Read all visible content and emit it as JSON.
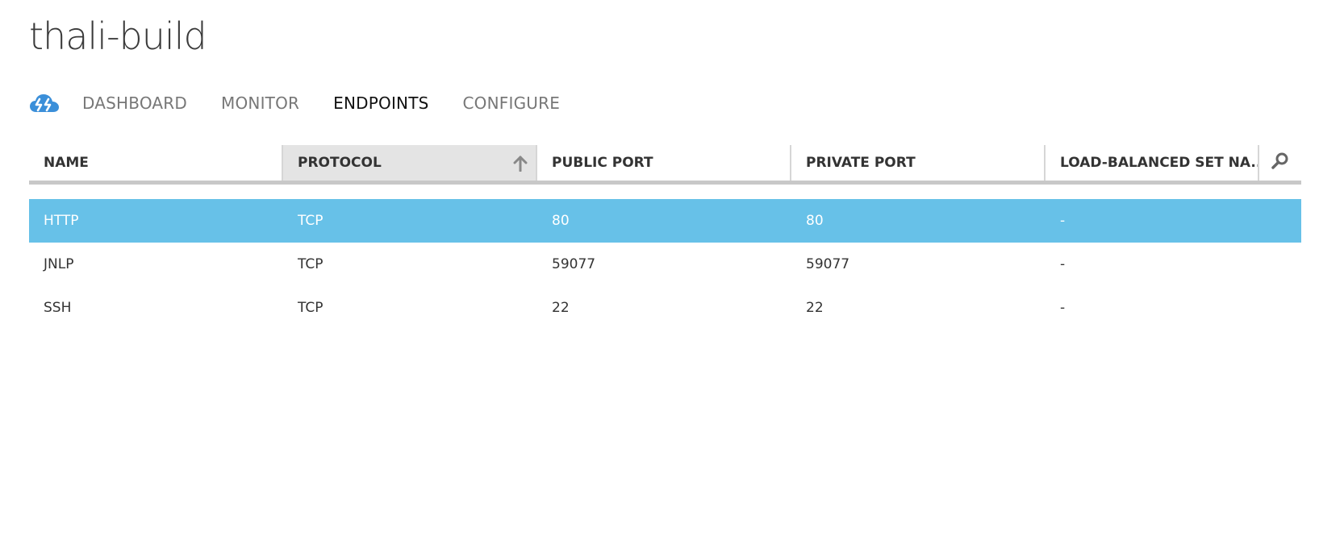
{
  "page": {
    "title": "thali-build"
  },
  "nav": {
    "logo_icon": "cloud-service-icon",
    "tabs": [
      {
        "label": "DASHBOARD",
        "active": false
      },
      {
        "label": "MONITOR",
        "active": false
      },
      {
        "label": "ENDPOINTS",
        "active": true
      },
      {
        "label": "CONFIGURE",
        "active": false
      }
    ]
  },
  "grid": {
    "columns": [
      {
        "label": "NAME"
      },
      {
        "label": "PROTOCOL",
        "sorted": "ascending"
      },
      {
        "label": "PUBLIC PORT"
      },
      {
        "label": "PRIVATE PORT"
      },
      {
        "label": "LOAD-BALANCED SET NA..."
      }
    ],
    "search_icon": "search-icon",
    "rows": [
      {
        "name": "HTTP",
        "protocol": "TCP",
        "public_port": "80",
        "private_port": "80",
        "lb_set": "-",
        "selected": true
      },
      {
        "name": "JNLP",
        "protocol": "TCP",
        "public_port": "59077",
        "private_port": "59077",
        "lb_set": "-",
        "selected": false
      },
      {
        "name": "SSH",
        "protocol": "TCP",
        "public_port": "22",
        "private_port": "22",
        "lb_set": "-",
        "selected": false
      }
    ]
  },
  "colors": {
    "selected_row": "#67c1e8",
    "sorted_header": "#e4e4e4",
    "logo_blue": "#3b8fd9"
  }
}
